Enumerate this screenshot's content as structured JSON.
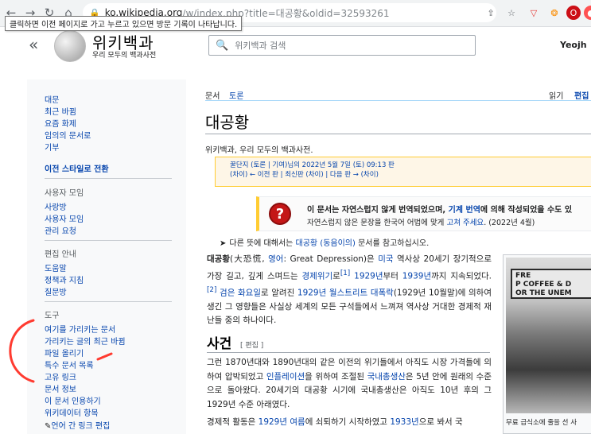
{
  "browser": {
    "url_host": "ko.wikipedia.org",
    "url_path": "/w/index.php?title=대공황&oldid=32593261",
    "tooltip": "클릭하면 이전 페이지로 가고 누르고 있으면 방문 기록이 나타납니다."
  },
  "header": {
    "wordmark": "위키백과",
    "tagline": "우리 모두의 백과사전",
    "search_placeholder": "위키백과 검색",
    "username": "Yeojh"
  },
  "sidebar": {
    "nav": [
      "대문",
      "최근 바뀜",
      "요즘 화제",
      "임의의 문서로",
      "기부"
    ],
    "switch_style": "이전 스타일로 전환",
    "community_head": "사용자 모임",
    "community": [
      "사랑방",
      "사용자 모임",
      "관리 요청"
    ],
    "help_head": "편집 안내",
    "help": [
      "도움말",
      "정책과 지침",
      "질문방"
    ],
    "tools_head": "도구",
    "tools": [
      "여기를 가리키는 문서",
      "가리키는 글의 최근 바뀜",
      "파일 올리기",
      "특수 문서 목록",
      "고유 링크",
      "문서 정보",
      "이 문서 인용하기",
      "위키데이터 항목"
    ],
    "interlang": "언어 간 링크 편집"
  },
  "tabs": {
    "article": "문서",
    "talk": "토론",
    "read": "읽기",
    "edit": "편집"
  },
  "article": {
    "title": "대공황",
    "from": "위키백과, 우리 모두의 백과사전.",
    "revision_line1": "꿀단지 (토론 | 기여)님의 2022년 5월 7일 (토) 09:13 판",
    "revision_line2": "(차이) ← 이전 판 | 최신판 (차이) | 다음 판 → (차이)",
    "notice_line1_a": "이 문서는 자연스럽지 않게 번역되었으며, ",
    "notice_line1_link": "기계 번역",
    "notice_line1_b": "에 의해 작성되었을 수도 있",
    "notice_line2_a": "자연스럽지 않은 문장을 한국어 어법에 맞게 ",
    "notice_line2_link": "고쳐 주세요",
    "notice_line2_b": ". (2022년 4월)",
    "hatnote_a": "다른 뜻에 대해서는 ",
    "hatnote_link": "대공황 (동음이의)",
    "hatnote_b": " 문서를 참고하십시오.",
    "p1_s1": "대공황",
    "p1_s2": "(大恐慌, ",
    "p1_s3": "영어",
    "p1_s4": ": Great Depression)은 ",
    "p1_s5": "미국",
    "p1_s6": " 역사상 20세기 장기적으로 가장 길고, 깊게 스며드는 ",
    "p1_s7": "경제위기",
    "p1_s8": "로",
    "p1_s9": "[1]",
    "p1_s10": " ",
    "p1_s11": "1929년",
    "p1_s12": "부터 ",
    "p1_s13": "1939년",
    "p1_s14": "까지 지속되었다.",
    "p1_s15": "[2]",
    "p1_s16": " ",
    "p1_s17": "검은 화요일",
    "p1_s18": "로 알려진 ",
    "p1_s19": "1929년 월스트리트 대폭락",
    "p1_s20": "(1929년 10월말)에 의하여 생긴 그 영향들은 사실상 세계의 모든 구석들에서 느껴져 역사상 거대한 경제적 재난들 중의 하나이다.",
    "section_title": "사건",
    "section_edit": "[ 편집 ]",
    "p2_s1": "그런 1870년대와 1890년대의 같은 이전의 위기들에서 아직도 시장 가격들에 의하여 압박되었고 ",
    "p2_s2": "인플레이션",
    "p2_s3": "을 위하여 조절된 ",
    "p2_s4": "국내총생산",
    "p2_s5": "은 5년 안에 원래의 수준으로 돌아왔다. 20세기의 대공황 시기에 국내총생산은 아직도 10년 후의 그 1929년 수준 아래였다.",
    "p3_s1": "경제적 활동은 ",
    "p3_s2": "1929년 여름",
    "p3_s3": "에 쇠퇴하기 시작하였고 ",
    "p3_s4": "1933년",
    "p3_s5": "으로 봐서 국",
    "thumb_sign_l1": "FRE",
    "thumb_sign_l2": "P COFFEE & D",
    "thumb_sign_l3": "OR THE UNEM",
    "thumb_caption": "무료 급식소에 줄을 선 사"
  }
}
